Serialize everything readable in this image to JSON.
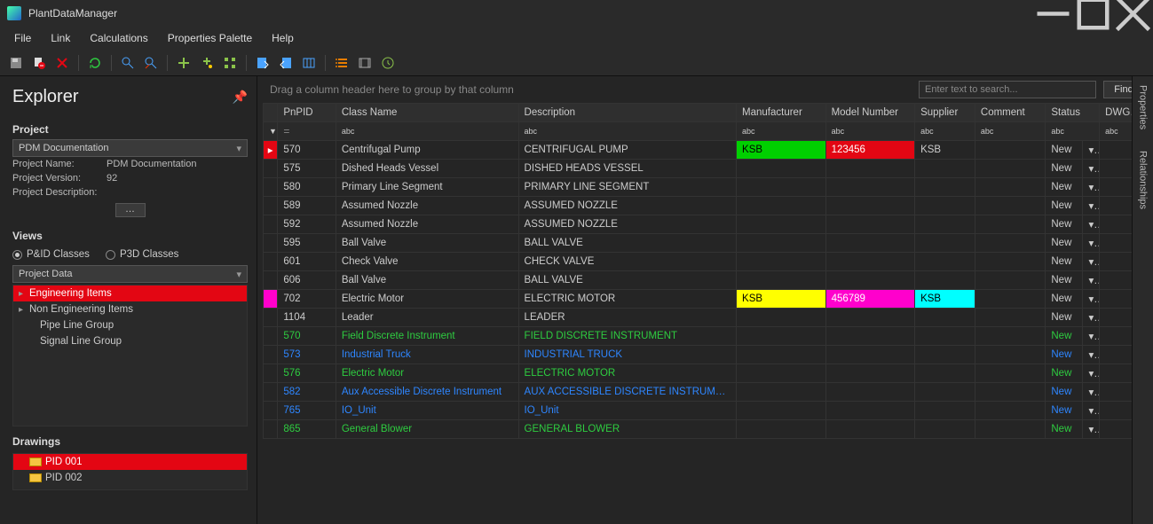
{
  "app": {
    "title": "PlantDataManager"
  },
  "menu": [
    "File",
    "Link",
    "Calculations",
    "Properties Palette",
    "Help"
  ],
  "explorer": {
    "title": "Explorer",
    "project_section": "Project",
    "project_combo": "PDM Documentation",
    "fields": [
      {
        "k": "Project Name:",
        "v": "PDM Documentation"
      },
      {
        "k": "Project Version:",
        "v": "92"
      },
      {
        "k": "Project Description:",
        "v": ""
      }
    ],
    "ellipsis": "…",
    "views_section": "Views",
    "radios": {
      "pid": "P&ID Classes",
      "p3d": "P3D Classes"
    },
    "views_combo": "Project Data",
    "views_tree": [
      "Engineering Items",
      "Non Engineering Items",
      "Pipe Line Group",
      "Signal Line Group"
    ],
    "drawings_section": "Drawings",
    "drawings": [
      "PID 001",
      "PID 002"
    ]
  },
  "grid": {
    "group_hint": "Drag a column header here to group by that column",
    "search_placeholder": "Enter text to search...",
    "find": "Find",
    "cols": [
      "PnPID",
      "Class Name",
      "Description",
      "Manufacturer",
      "Model Number",
      "Supplier",
      "Comment",
      "Status",
      "DWG ..."
    ],
    "filter_token": "abc",
    "rows": [
      {
        "mark": "red",
        "id": "570",
        "cls": "Centrifugal Pump",
        "desc": "CENTRIFUGAL PUMP",
        "mfr": "KSB",
        "mfr_hl": "green",
        "model": "123456",
        "model_hl": "red",
        "supp": "KSB",
        "status": "New"
      },
      {
        "id": "575",
        "cls": "Dished Heads Vessel",
        "desc": "DISHED HEADS VESSEL",
        "status": "New"
      },
      {
        "id": "580",
        "cls": "Primary Line Segment",
        "desc": "PRIMARY LINE SEGMENT",
        "status": "New"
      },
      {
        "id": "589",
        "cls": "Assumed Nozzle",
        "desc": "ASSUMED NOZZLE",
        "status": "New"
      },
      {
        "id": "592",
        "cls": "Assumed Nozzle",
        "desc": "ASSUMED NOZZLE",
        "status": "New"
      },
      {
        "id": "595",
        "cls": "Ball Valve",
        "desc": "BALL VALVE",
        "status": "New"
      },
      {
        "id": "601",
        "cls": "Check Valve",
        "desc": "CHECK VALVE",
        "status": "New"
      },
      {
        "id": "606",
        "cls": "Ball Valve",
        "desc": "BALL VALVE",
        "status": "New"
      },
      {
        "mark": "mag",
        "id": "702",
        "cls": "Electric Motor",
        "desc": "ELECTRIC MOTOR",
        "mfr": "KSB",
        "mfr_hl": "yellow",
        "model": "456789",
        "model_hl": "mag",
        "supp": "KSB",
        "supp_hl": "cyan",
        "status": "New"
      },
      {
        "id": "1104",
        "cls": "Leader",
        "desc": "LEADER",
        "status": "New"
      },
      {
        "id": "570",
        "cls": "Field Discrete Instrument",
        "desc": "FIELD DISCRETE INSTRUMENT",
        "color": "green",
        "status": "New"
      },
      {
        "id": "573",
        "cls": "Industrial Truck",
        "desc": "INDUSTRIAL TRUCK",
        "color": "blue",
        "status": "New"
      },
      {
        "id": "576",
        "cls": "Electric Motor",
        "desc": "ELECTRIC MOTOR",
        "color": "green",
        "status": "New"
      },
      {
        "id": "582",
        "cls": "Aux Accessible Discrete Instrument",
        "desc": "AUX ACCESSIBLE DISCRETE INSTRUMENT",
        "color": "blue",
        "status": "New"
      },
      {
        "id": "765",
        "cls": "IO_Unit",
        "desc": "IO_Unit",
        "color": "blue",
        "status": "New"
      },
      {
        "id": "865",
        "cls": "General Blower",
        "desc": "GENERAL BLOWER",
        "color": "green",
        "status": "New"
      }
    ]
  },
  "side": {
    "properties": "Properties",
    "relationships": "Relationships"
  }
}
